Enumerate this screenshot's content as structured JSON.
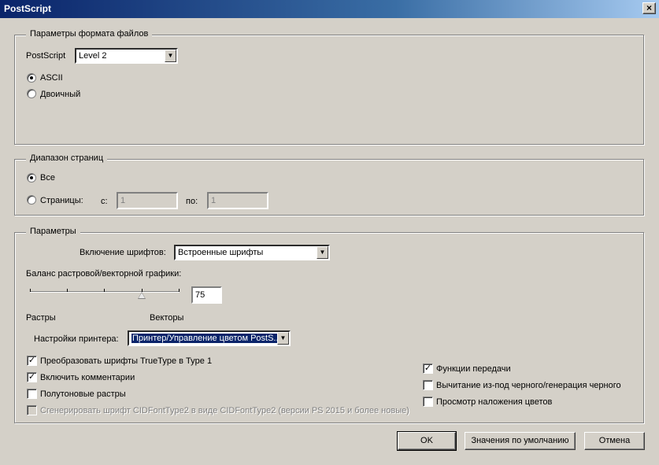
{
  "window": {
    "title": "PostScript",
    "close_glyph": "×"
  },
  "file_format": {
    "legend": "Параметры формата файлов",
    "postscript_label": "PostScript",
    "postscript_value": "Level 2",
    "ascii_label": "ASCII",
    "binary_label": "Двоичный",
    "selected_encoding": "ASCII"
  },
  "page_range": {
    "legend": "Диапазон страниц",
    "all_label": "Все",
    "pages_label": "Страницы:",
    "from_label": "с:",
    "from_value": "1",
    "to_label": "по:",
    "to_value": "1",
    "selected": "all"
  },
  "params": {
    "legend": "Параметры",
    "font_inclusion_label": "Включение шрифтов:",
    "font_inclusion_value": "Встроенные шрифты",
    "balance_label": "Баланс растровой/векторной графики:",
    "balance_value": "75",
    "raster_label": "Растры",
    "vector_label": "Векторы",
    "printer_settings_label": "Настройки принтера:",
    "printer_settings_value": "Принтер/Управление цветом PostS...",
    "checkboxes_left": [
      {
        "label": "Преобразовать шрифты TrueType в Type 1",
        "checked": true,
        "disabled": false
      },
      {
        "label": "Включить комментарии",
        "checked": true,
        "disabled": false
      },
      {
        "label": "Полутоновые растры",
        "checked": false,
        "disabled": false
      },
      {
        "label": "Сгенерировать шрифт CIDFontType2 в виде CIDFontType2 (версии PS 2015 и более новые)",
        "checked": false,
        "disabled": true
      }
    ],
    "checkboxes_right": [
      {
        "label": "Функции передачи",
        "checked": true
      },
      {
        "label": "Вычитание из-под черного/генерация черного",
        "checked": false
      },
      {
        "label": "Просмотр наложения цветов",
        "checked": false
      }
    ]
  },
  "buttons": {
    "ok": "OK",
    "defaults": "Значения по умолчанию",
    "cancel": "Отмена"
  },
  "icons": {
    "check": "✓",
    "dropdown": "▼"
  }
}
